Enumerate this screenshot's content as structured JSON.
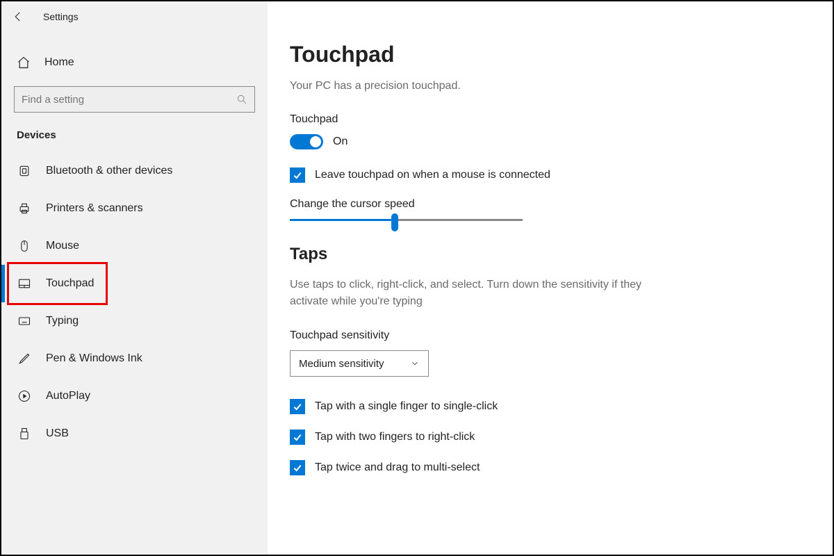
{
  "colors": {
    "accent": "#0078d4",
    "highlight": "#e60000"
  },
  "titlebar": {
    "app_title": "Settings"
  },
  "sidebar": {
    "home_label": "Home",
    "search_placeholder": "Find a setting",
    "category_label": "Devices",
    "items": [
      {
        "id": "bluetooth",
        "label": "Bluetooth & other devices",
        "icon": "bluetooth-icon",
        "active": false
      },
      {
        "id": "printers",
        "label": "Printers & scanners",
        "icon": "printer-icon",
        "active": false
      },
      {
        "id": "mouse",
        "label": "Mouse",
        "icon": "mouse-icon",
        "active": false
      },
      {
        "id": "touchpad",
        "label": "Touchpad",
        "icon": "touchpad-icon",
        "active": true,
        "highlighted": true
      },
      {
        "id": "typing",
        "label": "Typing",
        "icon": "keyboard-icon",
        "active": false
      },
      {
        "id": "pen",
        "label": "Pen & Windows Ink",
        "icon": "pen-icon",
        "active": false
      },
      {
        "id": "autoplay",
        "label": "AutoPlay",
        "icon": "autoplay-icon",
        "active": false
      },
      {
        "id": "usb",
        "label": "USB",
        "icon": "usb-icon",
        "active": false
      }
    ]
  },
  "main": {
    "title": "Touchpad",
    "precision_text": "Your PC has a precision touchpad.",
    "touchpad_toggle": {
      "label": "Touchpad",
      "state_text": "On",
      "on": true
    },
    "leave_on_checkbox": {
      "checked": true,
      "label": "Leave touchpad on when a mouse is connected"
    },
    "cursor_speed": {
      "label": "Change the cursor speed",
      "value_percent": 45
    },
    "taps_section": {
      "title": "Taps",
      "description": "Use taps to click, right-click, and select. Turn down the sensitivity if they activate while you're typing",
      "sensitivity_label": "Touchpad sensitivity",
      "sensitivity_value": "Medium sensitivity",
      "checks": [
        {
          "checked": true,
          "label": "Tap with a single finger to single-click"
        },
        {
          "checked": true,
          "label": "Tap with two fingers to right-click"
        },
        {
          "checked": true,
          "label": "Tap twice and drag to multi-select"
        }
      ]
    }
  }
}
